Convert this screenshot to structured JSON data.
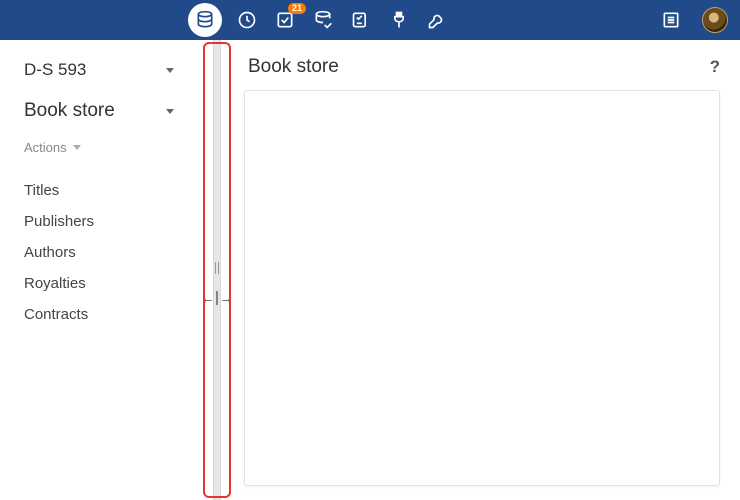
{
  "badge_count": "21",
  "sidebar": {
    "connection_label": "D-S 593",
    "schema_label": "Book store",
    "actions_label": "Actions",
    "nav": [
      "Titles",
      "Publishers",
      "Authors",
      "Royalties",
      "Contracts"
    ]
  },
  "main": {
    "title": "Book store",
    "help": "?"
  }
}
